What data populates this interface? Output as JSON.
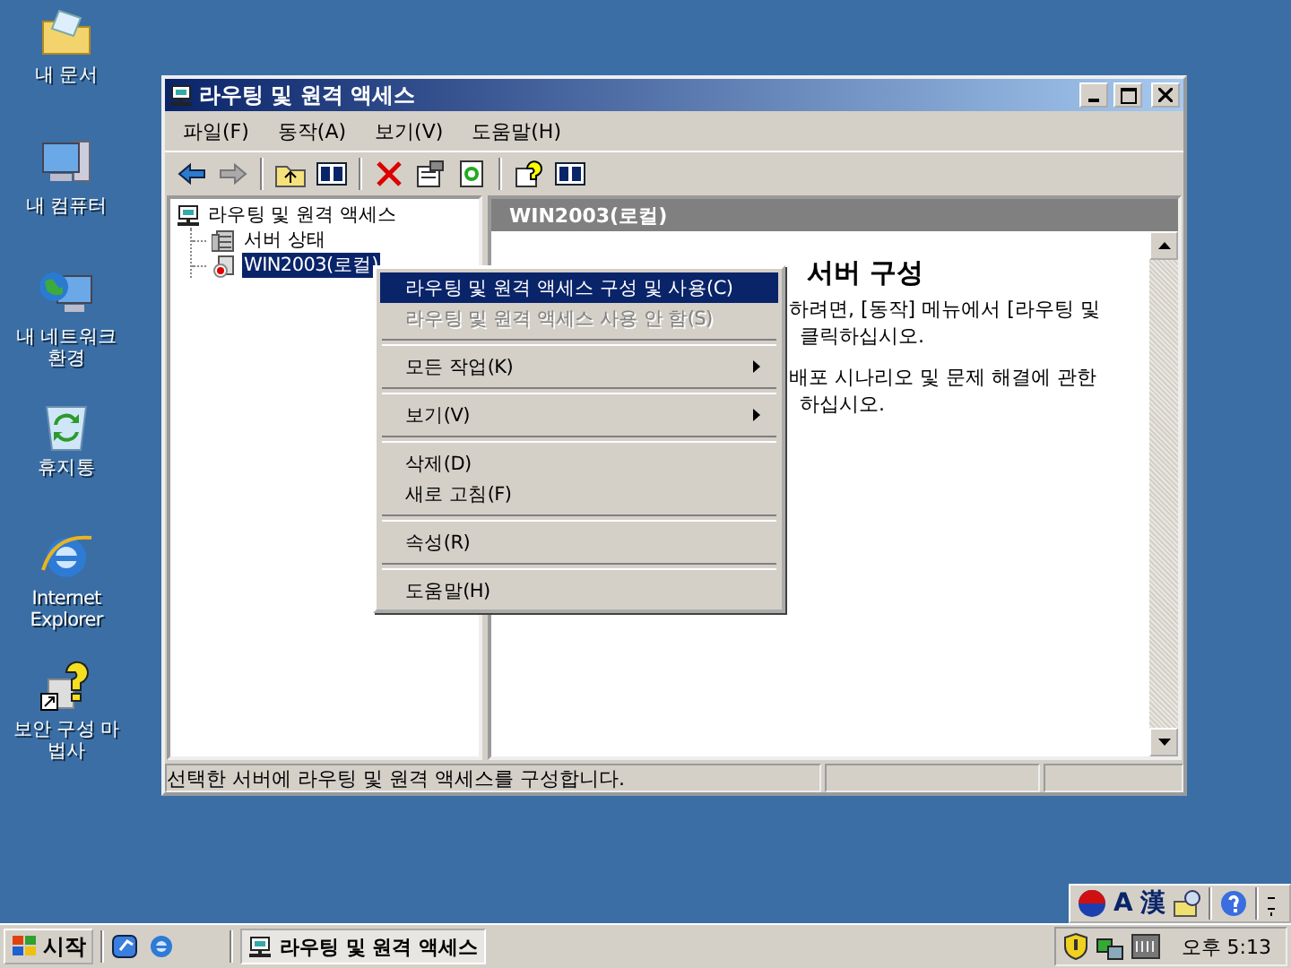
{
  "desktop_icons": [
    {
      "label": "내 문서",
      "kind": "documents"
    },
    {
      "label": "내 컴퓨터",
      "kind": "computer"
    },
    {
      "label": "내 네트워크 환경",
      "kind": "network"
    },
    {
      "label": "휴지통",
      "kind": "recycle"
    },
    {
      "label": "Internet Explorer",
      "kind": "browser"
    },
    {
      "label": "보안 구성 마법사",
      "kind": "wizard"
    }
  ],
  "window": {
    "title": "라우팅 및 원격 액세스",
    "menu": [
      "파일(F)",
      "동작(A)",
      "보기(V)",
      "도움말(H)"
    ],
    "tree": {
      "label": "라우팅 및 원격 액세스",
      "selected": false,
      "children": [
        {
          "label": "서버 상태",
          "kind": "status",
          "selected": false
        },
        {
          "label": "WIN2003(로컬)",
          "kind": "server",
          "selected": true
        }
      ]
    },
    "pane_header": "WIN2003(로컬)",
    "content": {
      "heading": "서버 구성",
      "paragraphs": [
        [
          "하려면, [동작] 메뉴에서 [라우팅 및",
          "클릭하십시오."
        ],
        [
          "배포 시나리오 및 문제 해결에 관한",
          "하십시오."
        ]
      ]
    },
    "status_bar": "선택한 서버에 라우팅 및 원격 액세스를 구성합니다."
  },
  "context_menu": [
    {
      "kind": "item",
      "label": "라우팅 및 원격 액세스 구성 및 사용(C)",
      "selected": true,
      "disabled": false,
      "submenu": false
    },
    {
      "kind": "item",
      "label": "라우팅 및 원격 액세스 사용 안 함(S)",
      "selected": false,
      "disabled": true,
      "submenu": false
    },
    {
      "kind": "separator"
    },
    {
      "kind": "item",
      "label": "모든 작업(K)",
      "selected": false,
      "disabled": false,
      "submenu": true
    },
    {
      "kind": "separator"
    },
    {
      "kind": "item",
      "label": "보기(V)",
      "selected": false,
      "disabled": false,
      "submenu": true
    },
    {
      "kind": "separator"
    },
    {
      "kind": "item",
      "label": "삭제(D)",
      "selected": false,
      "disabled": false,
      "submenu": false
    },
    {
      "kind": "item",
      "label": "새로 고침(F)",
      "selected": false,
      "disabled": false,
      "submenu": false
    },
    {
      "kind": "separator"
    },
    {
      "kind": "item",
      "label": "속성(R)",
      "selected": false,
      "disabled": false,
      "submenu": false
    },
    {
      "kind": "separator"
    },
    {
      "kind": "item",
      "label": "도움말(H)",
      "selected": false,
      "disabled": false,
      "submenu": false
    }
  ],
  "language_bar": {
    "input_mode": "A",
    "hanja": "漢"
  },
  "taskbar": {
    "start": "시작",
    "tasks": [
      {
        "label": "라우팅 및 원격 액세스",
        "selected": true
      }
    ],
    "clock": "오후 5:13"
  }
}
